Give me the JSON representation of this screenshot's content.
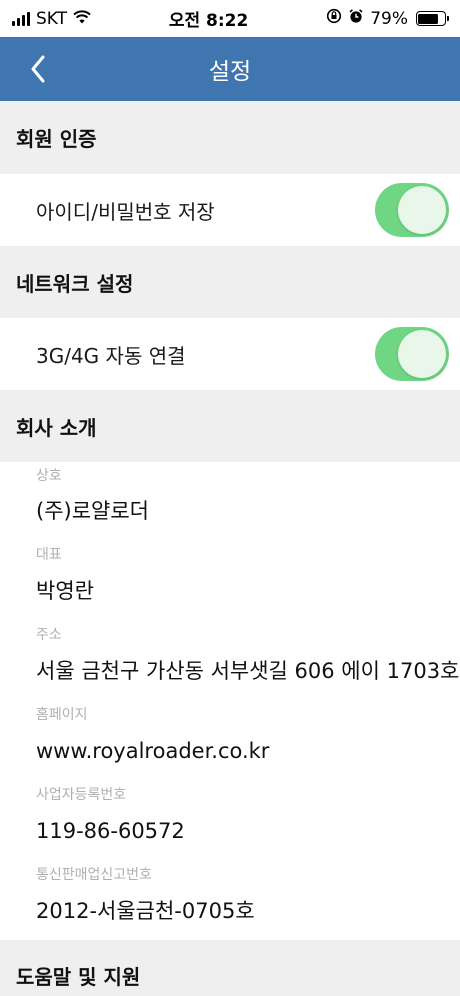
{
  "status_bar": {
    "carrier": "SKT",
    "time": "오전 8:22",
    "battery_percent": "79%",
    "battery_level": 0.79,
    "icons": [
      "signal-icon",
      "wifi-icon",
      "orientation-lock-icon",
      "alarm-icon",
      "battery-icon"
    ]
  },
  "nav": {
    "title": "설정",
    "back_icon": "chevron-left-icon"
  },
  "sections": {
    "member_auth": {
      "title": "회원 인증",
      "toggle_label": "아이디/비밀번호 저장",
      "toggle_on": true
    },
    "network": {
      "title": "네트워크 설정",
      "toggle_label": "3G/4G 자동 연결",
      "toggle_on": true
    },
    "company": {
      "title": "회사 소개",
      "items": [
        {
          "label": "상호",
          "value": "(주)로얄로더"
        },
        {
          "label": "대표",
          "value": "박영란"
        },
        {
          "label": "주소",
          "value": "서울 금천구 가산동 서부샛길 606 에이 1703호"
        },
        {
          "label": "홈페이지",
          "value": "www.royalroader.co.kr"
        },
        {
          "label": "사업자등록번호",
          "value": "119-86-60572"
        },
        {
          "label": "통신판매업신고번호",
          "value": "2012-서울금천-0705호"
        }
      ]
    },
    "help": {
      "title": "도움말 및 지원"
    }
  },
  "colors": {
    "nav_background": "#3f76b0",
    "section_background": "#efefef",
    "toggle_on": "#6fd683",
    "label_gray": "#b0b0b0"
  }
}
